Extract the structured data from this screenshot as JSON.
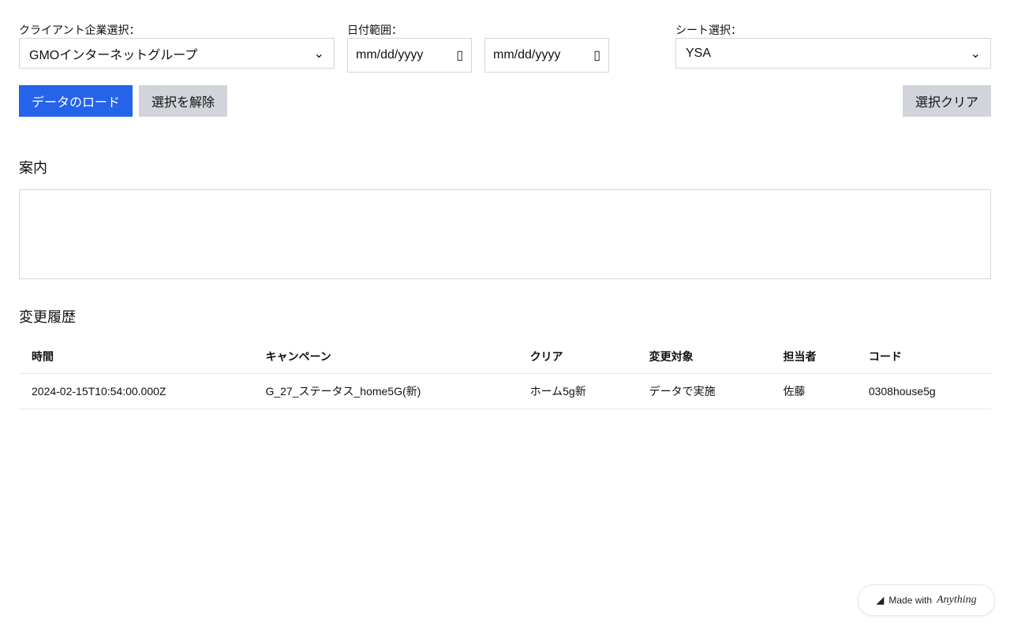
{
  "filters": {
    "client_label": "クライアント企業選択：",
    "client_value": "GMOインターネットグループ",
    "date_label": "日付範囲：",
    "date_start": "mm/dd/yyyy",
    "date_end": "mm/dd/yyyy",
    "sheet_label": "シート選択：",
    "sheet_value": "YSA"
  },
  "buttons": {
    "load": "データのロード",
    "deselect": "選択を解除",
    "clear": "選択クリア"
  },
  "guide": {
    "title": "案内"
  },
  "history": {
    "title": "変更履歴",
    "columns": [
      "時間",
      "キャンペーン",
      "クリア",
      "変更対象",
      "担当者",
      "コード"
    ],
    "rows": [
      [
        "2024-02-15T10:54:00.000Z",
        "G_27_ステータス_home5G(新)",
        "ホーム5g新",
        "データで実施",
        "佐藤",
        "0308house5g"
      ]
    ]
  },
  "badge": {
    "made_with": "Made with",
    "brand": "Anything"
  },
  "colors": {
    "primary": "#2563eb"
  }
}
